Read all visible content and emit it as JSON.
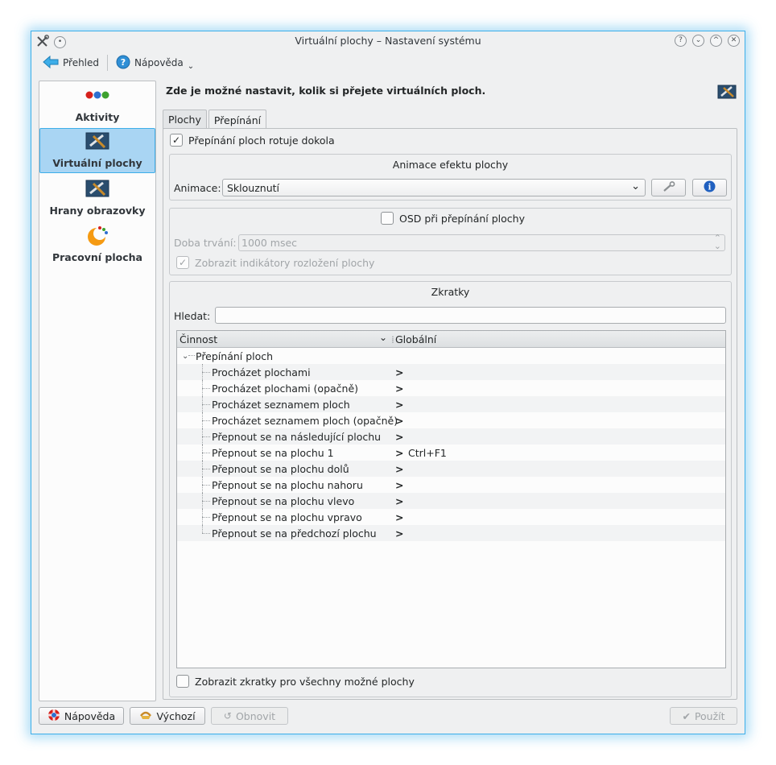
{
  "window": {
    "title": "Virtuální plochy – Nastavení systému"
  },
  "toolbar": {
    "overview_label": "Přehled",
    "help_label": "Nápověda"
  },
  "sidebar": {
    "items": [
      {
        "label": "Aktivity",
        "icon": "activities-icon",
        "selected": false
      },
      {
        "label": "Virtuální plochy",
        "icon": "virtual-desktops-icon",
        "selected": true
      },
      {
        "label": "Hrany obrazovky",
        "icon": "screen-edges-icon",
        "selected": false
      },
      {
        "label": "Pracovní plocha",
        "icon": "desktop-icon",
        "selected": false
      }
    ]
  },
  "main": {
    "headline": "Zde je možné nastavit, kolik si přejete virtuálních ploch.",
    "tabs": [
      {
        "label": "Plochy",
        "active": false
      },
      {
        "label": "Přepínání",
        "active": true
      }
    ],
    "wrap_checkbox": {
      "label": "Přepínání ploch rotuje dokola",
      "checked": true
    },
    "animation_group": {
      "title": "Animace efektu plochy",
      "animation_label": "Animace:",
      "animation_value": "Sklouznutí"
    },
    "osd_group": {
      "checkbox_label": "OSD při přepínání plochy",
      "checked": false,
      "duration_label": "Doba trvání:",
      "duration_value": "1000 msec",
      "layout_label": "Zobrazit indikátory rozložení plochy",
      "layout_checked": true
    },
    "shortcuts_group": {
      "title": "Zkratky",
      "search_label": "Hledat:",
      "search_value": "",
      "columns": [
        "Činnost",
        "Globální"
      ],
      "root": "Přepínání ploch",
      "rows": [
        {
          "action": "Procházet plochami",
          "shortcut": ""
        },
        {
          "action": "Procházet plochami (opačně)",
          "shortcut": ""
        },
        {
          "action": "Procházet seznamem ploch",
          "shortcut": ""
        },
        {
          "action": "Procházet seznamem ploch (opačně)",
          "shortcut": ""
        },
        {
          "action": "Přepnout se na následující plochu",
          "shortcut": ""
        },
        {
          "action": "Přepnout se na plochu 1",
          "shortcut": "Ctrl+F1"
        },
        {
          "action": "Přepnout se na plochu dolů",
          "shortcut": ""
        },
        {
          "action": "Přepnout se na plochu nahoru",
          "shortcut": ""
        },
        {
          "action": "Přepnout se na plochu vlevo",
          "shortcut": ""
        },
        {
          "action": "Přepnout se na plochu vpravo",
          "shortcut": ""
        },
        {
          "action": "Přepnout se na předchozí plochu",
          "shortcut": ""
        }
      ],
      "show_all_label": "Zobrazit zkratky pro všechny možné plochy",
      "show_all_checked": false
    }
  },
  "buttons": {
    "help": "Nápověda",
    "defaults": "Výchozí",
    "reset": "Obnovit",
    "apply": "Použít"
  },
  "colors": {
    "accent": "#3daee9",
    "selection": "#a9d5f3",
    "background": "#eff0f1"
  }
}
